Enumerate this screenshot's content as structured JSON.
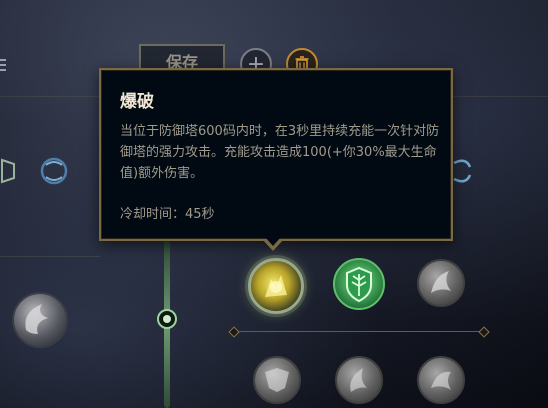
{
  "toolbar": {
    "save_label": "保存",
    "add_label": "+"
  },
  "tooltip": {
    "title": "爆破",
    "description": "当位于防御塔600码内时，在3秒里持续充能一次针对防御塔的强力攻击。充能攻击造成100(+你30%最大生命值)额外伤害。",
    "cooldown": "冷却时间：45秒"
  },
  "icons": {
    "add": "plus-icon",
    "delete": "trash-icon",
    "selected_rune": "demolish-icon",
    "second_rune": "shield-leaf-icon"
  },
  "colors": {
    "tooltip_border": "#7a6a43",
    "tooltip_bg": "#010a13",
    "title_color": "#f0e6d2",
    "text_color": "#a09b8c",
    "accent_gold": "#c28a2c",
    "path_green": "#6f9d74"
  }
}
